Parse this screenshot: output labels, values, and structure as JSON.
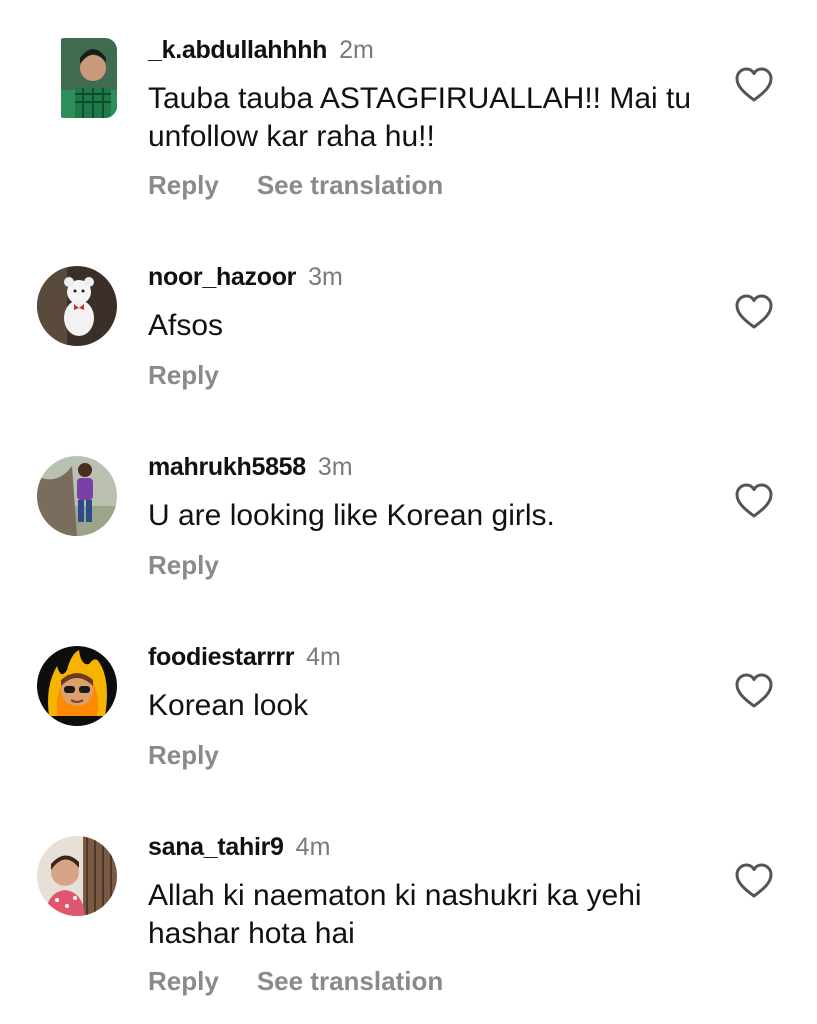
{
  "comments": [
    {
      "username": "_k.abdullahhhh",
      "time": "2m",
      "text": "Tauba tauba ASTAGFIRUALLAH!! Mai tu unfollow kar raha hu!!",
      "reply": "Reply",
      "translate": "See translation"
    },
    {
      "username": "noor_hazoor",
      "time": "3m",
      "text": "Afsos",
      "reply": "Reply"
    },
    {
      "username": "mahrukh5858",
      "time": "3m",
      "text": "U are looking like Korean girls.",
      "reply": "Reply"
    },
    {
      "username": "foodiestarrrr",
      "time": "4m",
      "text": "Korean look",
      "reply": "Reply"
    },
    {
      "username": "sana_tahir9",
      "time": "4m",
      "text": "Allah ki naematon ki nashukri ka yehi hashar hota hai",
      "reply": "Reply",
      "translate": "See translation"
    }
  ],
  "colors": {
    "text": "#111111",
    "muted": "#8a8a8a",
    "timestamp": "#7a7a7a",
    "background": "#ffffff"
  },
  "icons": {
    "like": "heart-outline-icon"
  }
}
